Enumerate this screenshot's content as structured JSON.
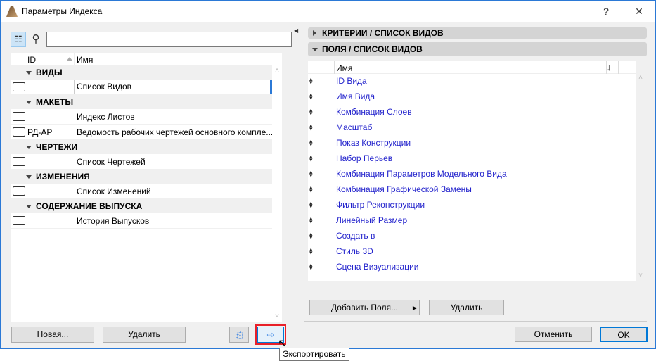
{
  "window": {
    "title": "Параметры Индекса",
    "help": "?",
    "close": "✕"
  },
  "left": {
    "search_value": "",
    "columns": {
      "id": "ID",
      "name": "Имя"
    },
    "groups": [
      {
        "label": "ВИДЫ",
        "items": [
          {
            "id": "",
            "name": "Список Видов"
          }
        ]
      },
      {
        "label": "МАКЕТЫ",
        "items": [
          {
            "id": "",
            "name": "Индекс Листов"
          },
          {
            "id": "РД-АР",
            "name": "Ведомость рабочих чертежей основного компле..."
          }
        ]
      },
      {
        "label": "ЧЕРТЕЖИ",
        "items": [
          {
            "id": "",
            "name": "Список Чертежей"
          }
        ]
      },
      {
        "label": "ИЗМЕНЕНИЯ",
        "items": [
          {
            "id": "",
            "name": "Список Изменений"
          }
        ]
      },
      {
        "label": "СОДЕРЖАНИЕ ВЫПУСКА",
        "items": [
          {
            "id": "",
            "name": "История Выпусков"
          }
        ]
      }
    ],
    "new_label": "Новая...",
    "delete_label": "Удалить"
  },
  "right": {
    "criteria_header": "КРИТЕРИИ /  СПИСОК ВИДОВ",
    "fields_header": "ПОЛЯ /  СПИСОК ВИДОВ",
    "column_name": "Имя",
    "sort_arrow": "↓",
    "fields": [
      "ID Вида",
      "Имя Вида",
      "Комбинация Слоев",
      "Масштаб",
      "Показ Конструкции",
      "Набор Перьев",
      "Комбинация Параметров Модельного Вида",
      "Комбинация Графической Замены",
      "Фильтр Реконструкции",
      "Линейный Размер",
      "Создать в",
      "Стиль 3D",
      "Сцена Визуализации"
    ],
    "add_fields_label": "Добавить Поля...",
    "delete_label": "Удалить"
  },
  "footer": {
    "cancel_label": "Отменить",
    "ok_label": "OK"
  },
  "tooltip": "Экспортировать"
}
